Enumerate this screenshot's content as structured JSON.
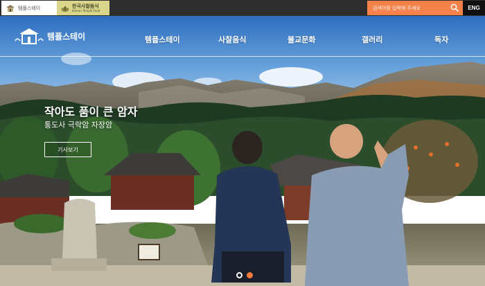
{
  "topbar": {
    "logo1_text": "템플스테이",
    "logo2_title": "한국사찰음식",
    "logo2_sub": "Korean Temple Food",
    "search_placeholder": "검색어를 입력해 주세요",
    "lang_label": "ENG"
  },
  "nav": {
    "logo_text": "템플스테이",
    "items": [
      "템플스테이",
      "사찰음식",
      "불교문화",
      "갤러리",
      "독자"
    ]
  },
  "hero": {
    "title": "작아도 품이 큰 암자",
    "subtitle": "통도사 극락암 자장암",
    "button_label": "기사보기"
  },
  "colors": {
    "accent": "#f4824a",
    "topbar_bg": "#2d2d2d",
    "logo2_bg": "#d9d58a",
    "dot_active": "#f27b3c"
  },
  "icons": {
    "search": "search-icon",
    "logo": "temple-logo-icon"
  },
  "carousel": {
    "slide_count": 2,
    "active_index": 1
  }
}
